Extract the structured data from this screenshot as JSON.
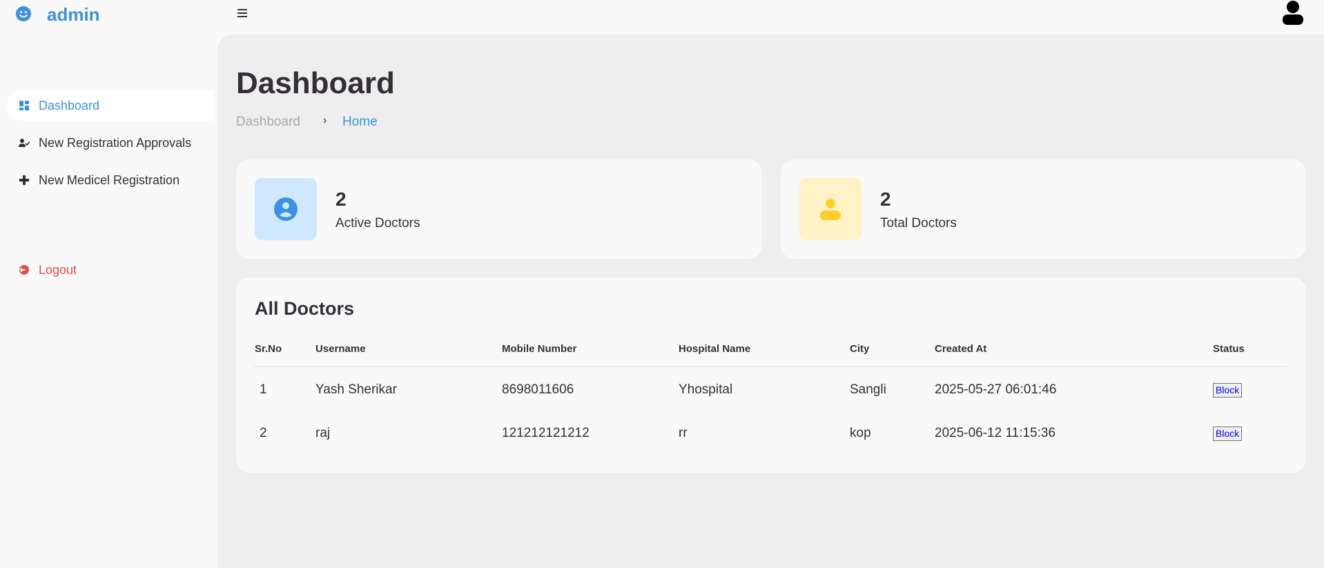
{
  "brand": {
    "name": "admin",
    "icon": "smile-icon"
  },
  "topnav": {
    "menu_icon": "hamburger-icon",
    "profile_icon": "user-icon"
  },
  "sidebar": {
    "items": [
      {
        "label": "Dashboard",
        "icon": "grid-icon",
        "active": true
      },
      {
        "label": "New Registration Approvals",
        "icon": "user-check-icon",
        "active": false
      },
      {
        "label": "New Medicel Registration",
        "icon": "plus-icon",
        "active": false
      }
    ],
    "logout": {
      "label": "Logout",
      "icon": "logout-icon"
    }
  },
  "header": {
    "title": "Dashboard",
    "breadcrumb": [
      "Dashboard",
      "Home"
    ]
  },
  "stats": [
    {
      "value": "2",
      "label": "Active Doctors",
      "icon": "user-circle-icon",
      "color": "#3c91e6",
      "bg": "#cfe8ff"
    },
    {
      "value": "2",
      "label": "Total Doctors",
      "icon": "user-icon",
      "color": "#ffce26",
      "bg": "#fff2c6"
    }
  ],
  "table": {
    "title": "All Doctors",
    "columns": [
      "Sr.No",
      "Username",
      "Mobile Number",
      "Hospital Name",
      "City",
      "Created At",
      "Status"
    ],
    "rows": [
      [
        "1",
        "Yash Sherikar",
        "8698011606",
        "Yhospital",
        "Sangli",
        "2025-05-27 06:01:46",
        "Block"
      ],
      [
        "2",
        "raj",
        "121212121212",
        "rr",
        "kop",
        "2025-06-12 11:15:36",
        "Block"
      ]
    ]
  },
  "colors": {
    "accent": "#3c91e6",
    "danger": "#db504a",
    "dark": "#342e37",
    "main_bg": "#eeeeee"
  }
}
